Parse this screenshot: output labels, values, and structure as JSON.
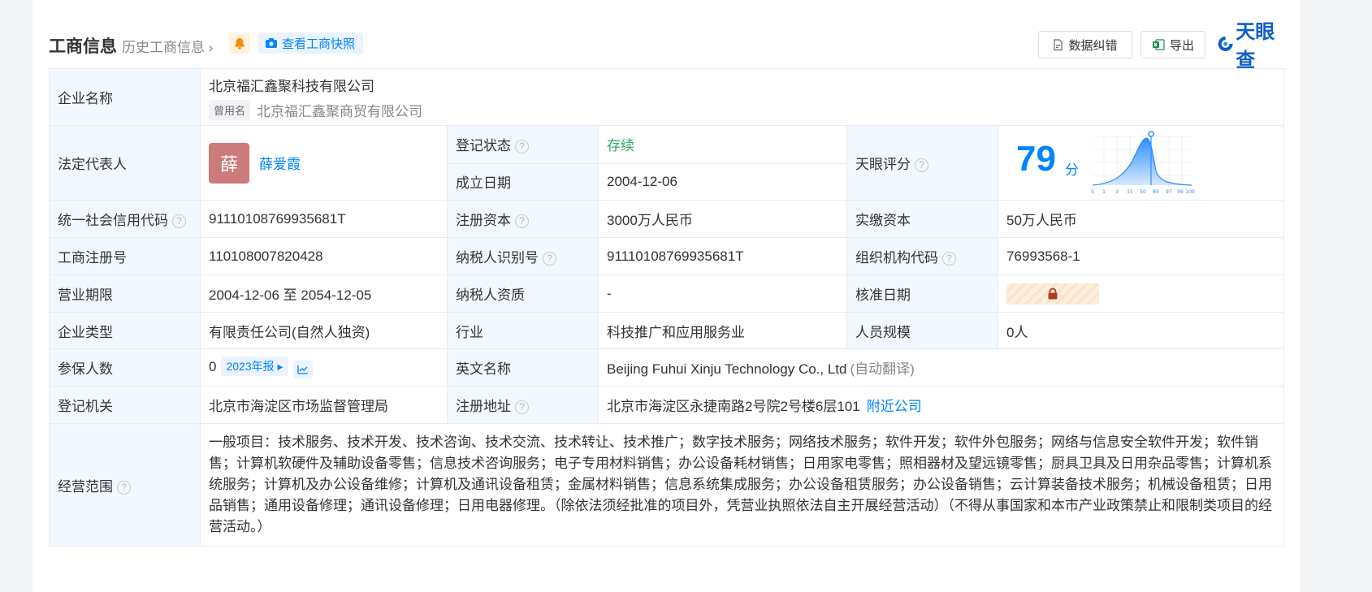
{
  "header": {
    "title": "工商信息",
    "history": "历史工商信息",
    "snapshot": "查看工商快照",
    "correct": "数据纠错",
    "export": "导出",
    "logo": "天眼查"
  },
  "labels": {
    "company_name": "企业名称",
    "former_name_tag": "曾用名",
    "legal_rep": "法定代表人",
    "reg_status": "登记状态",
    "founded": "成立日期",
    "score": "天眼评分",
    "credit_code": "统一社会信用代码",
    "reg_capital": "注册资本",
    "paid_capital": "实缴资本",
    "biz_reg_no": "工商注册号",
    "taxpayer_id": "纳税人识别号",
    "org_code": "组织机构代码",
    "term": "营业期限",
    "taxpayer_qual": "纳税人资质",
    "approval_date": "核准日期",
    "company_type": "企业类型",
    "industry": "行业",
    "staff_size": "人员规模",
    "insured": "参保人数",
    "english_name": "英文名称",
    "reg_authority": "登记机关",
    "reg_address": "注册地址",
    "scope": "经营范围"
  },
  "values": {
    "company_name": "北京福汇鑫聚科技有限公司",
    "former_name": "北京福汇鑫聚商贸有限公司",
    "legal_rep_avatar": "薛",
    "legal_rep_name": "薛爱霞",
    "reg_status": "存续",
    "founded": "2004-12-06",
    "score": "79",
    "score_unit": "分",
    "credit_code": "91110108769935681T",
    "reg_capital": "3000万人民币",
    "paid_capital": "50万人民币",
    "biz_reg_no": "110108007820428",
    "taxpayer_id": "91110108769935681T",
    "org_code": "76993568-1",
    "term": "2004-12-06 至 2054-12-05",
    "taxpayer_qual": "-",
    "company_type": "有限责任公司(自然人独资)",
    "industry": "科技推广和应用服务业",
    "staff_size": "0人",
    "insured": "0",
    "insured_report": "2023年报",
    "english_name": "Beijing Fuhui Xinju Technology Co., Ltd",
    "english_auto": "(自动翻译)",
    "reg_authority": "北京市海淀区市场监督管理局",
    "reg_address": "北京市海淀区永捷南路2号院2号楼6层101",
    "nearby": "附近公司",
    "scope": "一般项目：技术服务、技术开发、技术咨询、技术交流、技术转让、技术推广；数字技术服务；网络技术服务；软件开发；软件外包服务；网络与信息安全软件开发；软件销售；计算机软硬件及辅助设备零售；信息技术咨询服务；电子专用材料销售；办公设备耗材销售；日用家电零售；照相器材及望远镜零售；厨具卫具及日用杂品零售；计算机系统服务；计算机及办公设备维修；计算机及通讯设备租赁；金属材料销售；信息系统集成服务；办公设备租赁服务；办公设备销售；云计算装备技术服务；机械设备租赁；日用品销售；通用设备修理；通讯设备修理；日用电器修理。（除依法须经批准的项目外，凭营业执照依法自主开展经营活动）（不得从事国家和本市产业政策禁止和限制类项目的经营活动。）"
  },
  "score_chart": {
    "ticks": [
      "0",
      "1",
      "3",
      "15",
      "50",
      "85",
      "97",
      "99",
      "100"
    ],
    "marker_value": 79
  },
  "colors": {
    "accent": "#0084ff",
    "label_bg": "#f2f8ff",
    "status_green": "#2bab5e",
    "avatar": "#cc7a7a"
  },
  "icons": {
    "bell": "bell-icon",
    "camera": "camera-icon",
    "correct": "document-icon",
    "export": "excel-icon",
    "help": "question-icon",
    "lock": "lock-icon",
    "trend": "trend-icon"
  }
}
